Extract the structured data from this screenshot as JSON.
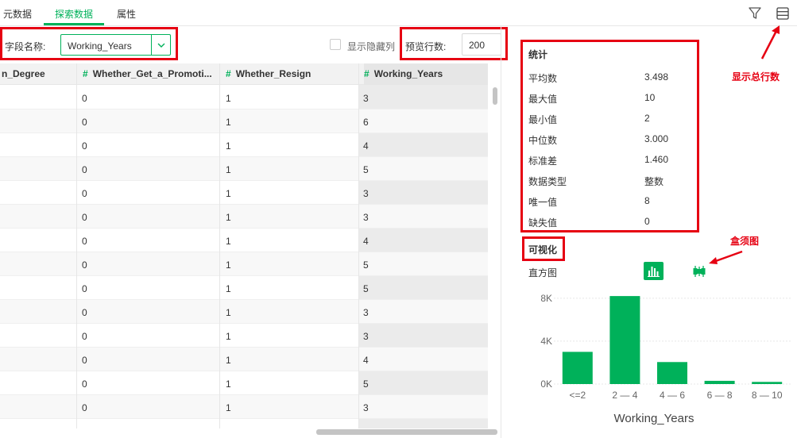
{
  "tabs": [
    "元数据",
    "探索数据",
    "属性"
  ],
  "active_tab": "探索数据",
  "top_icons": [
    "filter-icon",
    "rows-icon"
  ],
  "field": {
    "label": "字段名称:",
    "value": "Working_Years"
  },
  "show_hidden_label": "显示隐藏列",
  "preview": {
    "label": "预览行数:",
    "value": "200"
  },
  "table": {
    "columns": [
      "n_Degree",
      "Whether_Get_a_Promoti...",
      "Whether_Resign",
      "Working_Years"
    ],
    "rows": [
      [
        "",
        "0",
        "1",
        "3"
      ],
      [
        "",
        "0",
        "1",
        "6"
      ],
      [
        "",
        "0",
        "1",
        "4"
      ],
      [
        "",
        "0",
        "1",
        "5"
      ],
      [
        "",
        "0",
        "1",
        "3"
      ],
      [
        "",
        "0",
        "1",
        "3"
      ],
      [
        "",
        "0",
        "1",
        "4"
      ],
      [
        "",
        "0",
        "1",
        "5"
      ],
      [
        "",
        "0",
        "1",
        "5"
      ],
      [
        "",
        "0",
        "1",
        "3"
      ],
      [
        "",
        "0",
        "1",
        "3"
      ],
      [
        "",
        "0",
        "1",
        "4"
      ],
      [
        "",
        "0",
        "1",
        "5"
      ],
      [
        "",
        "0",
        "1",
        "3"
      ]
    ]
  },
  "stats": {
    "title": "统计",
    "items": [
      {
        "label": "平均数",
        "value": "3.498"
      },
      {
        "label": "最大值",
        "value": "10"
      },
      {
        "label": "最小值",
        "value": "2"
      },
      {
        "label": "中位数",
        "value": "3.000"
      },
      {
        "label": "标准差",
        "value": "1.460"
      },
      {
        "label": "数据类型",
        "value": "整数"
      },
      {
        "label": "唯一值",
        "value": "8"
      },
      {
        "label": "缺失值",
        "value": "0"
      }
    ]
  },
  "annotations": {
    "total_rows": "显示总行数",
    "boxplot": "盒须图"
  },
  "visual": {
    "title": "可视化",
    "hist_label": "直方图"
  },
  "colors": {
    "accent": "#00b15a",
    "annotation": "#e60012"
  },
  "chart_data": {
    "type": "bar",
    "categories": [
      "<=2",
      "2 — 4",
      "4 — 6",
      "6 — 8",
      "8 — 10"
    ],
    "values": [
      3000,
      8200,
      2050,
      300,
      200
    ],
    "xlabel": "Working_Years",
    "ylabel": "",
    "yticks": [
      "0K",
      "4K",
      "8K"
    ],
    "ytick_values": [
      0,
      4000,
      8000
    ],
    "ylim": [
      0,
      8800
    ],
    "grid": true
  }
}
